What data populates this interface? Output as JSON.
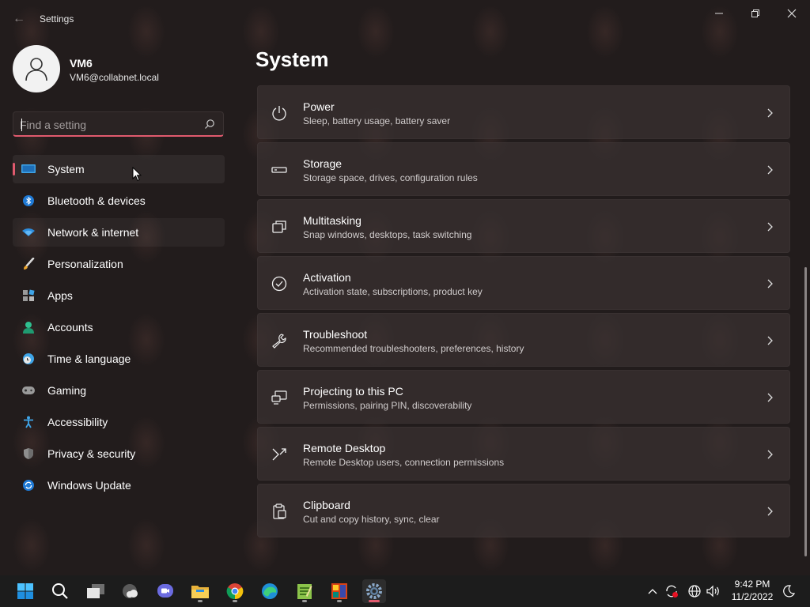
{
  "window": {
    "app_title": "Settings",
    "back_label": "←"
  },
  "user": {
    "name": "VM6",
    "email": "VM6@collabnet.local"
  },
  "search": {
    "placeholder": "Find a setting",
    "value": ""
  },
  "nav": {
    "items": [
      {
        "label": "System",
        "icon": "system-icon",
        "selected": true
      },
      {
        "label": "Bluetooth & devices",
        "icon": "bluetooth-icon"
      },
      {
        "label": "Network & internet",
        "icon": "network-icon",
        "hovered": true
      },
      {
        "label": "Personalization",
        "icon": "brush-icon"
      },
      {
        "label": "Apps",
        "icon": "apps-icon"
      },
      {
        "label": "Accounts",
        "icon": "accounts-icon"
      },
      {
        "label": "Time & language",
        "icon": "clock-globe-icon"
      },
      {
        "label": "Gaming",
        "icon": "gamepad-icon"
      },
      {
        "label": "Accessibility",
        "icon": "accessibility-icon"
      },
      {
        "label": "Privacy & security",
        "icon": "shield-icon"
      },
      {
        "label": "Windows Update",
        "icon": "update-icon"
      }
    ]
  },
  "main": {
    "title": "System",
    "cards": [
      {
        "title": "Power",
        "subtitle": "Sleep, battery usage, battery saver",
        "icon": "power-icon"
      },
      {
        "title": "Storage",
        "subtitle": "Storage space, drives, configuration rules",
        "icon": "storage-icon"
      },
      {
        "title": "Multitasking",
        "subtitle": "Snap windows, desktops, task switching",
        "icon": "multitasking-icon"
      },
      {
        "title": "Activation",
        "subtitle": "Activation state, subscriptions, product key",
        "icon": "activation-icon"
      },
      {
        "title": "Troubleshoot",
        "subtitle": "Recommended troubleshooters, preferences, history",
        "icon": "wrench-icon"
      },
      {
        "title": "Projecting to this PC",
        "subtitle": "Permissions, pairing PIN, discoverability",
        "icon": "projecting-icon"
      },
      {
        "title": "Remote Desktop",
        "subtitle": "Remote Desktop users, connection permissions",
        "icon": "remote-desktop-icon"
      },
      {
        "title": "Clipboard",
        "subtitle": "Cut and copy history, sync, clear",
        "icon": "clipboard-icon"
      }
    ]
  },
  "taskbar": {
    "apps": [
      "start-icon",
      "search-icon",
      "task-view-icon",
      "widgets-icon",
      "teams-chat-icon",
      "file-explorer-icon",
      "chrome-icon",
      "edge-icon",
      "notepad-icon",
      "app-icon",
      "settings-icon"
    ],
    "time": "9:42 PM",
    "date": "11/2/2022"
  },
  "colors": {
    "accent": "#e05a6e",
    "background": "#221c1c",
    "card": "#3a3232"
  }
}
